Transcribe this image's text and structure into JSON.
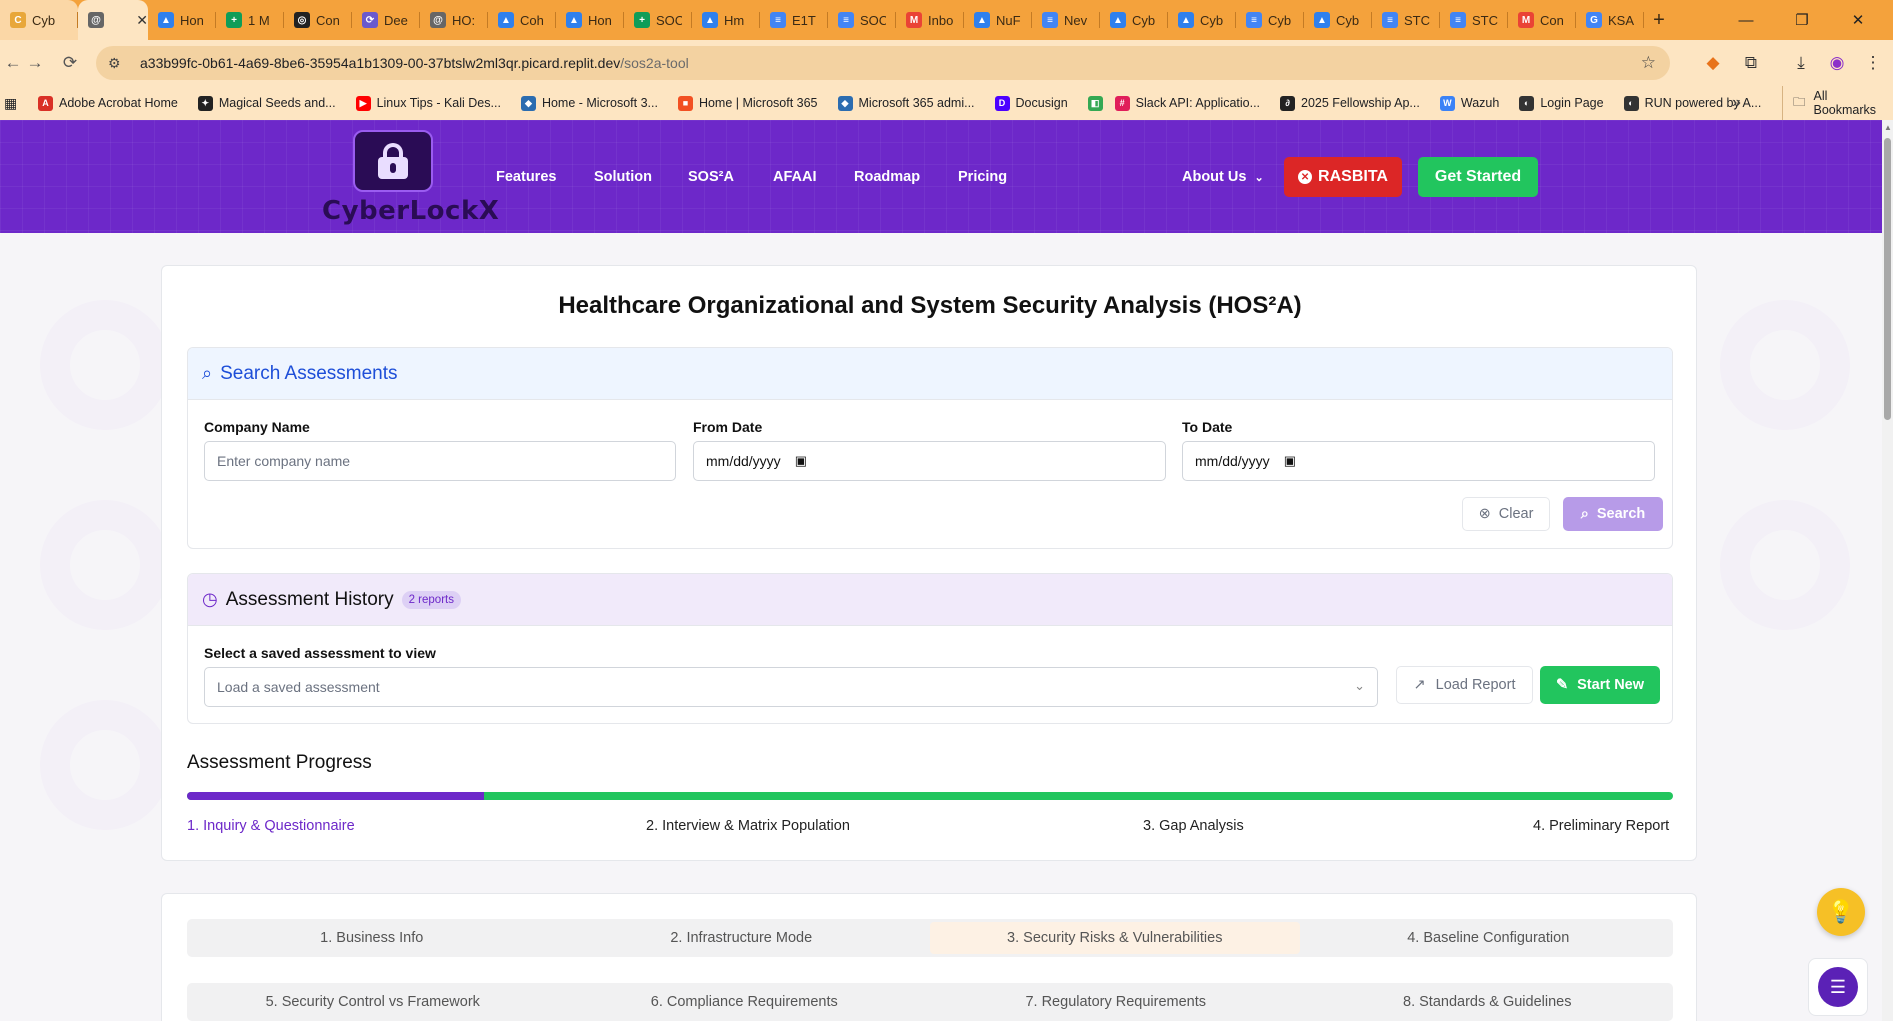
{
  "browser": {
    "tabs": [
      {
        "title": "Cyb",
        "color": "#e8a73a",
        "icon": "C"
      },
      {
        "title": "",
        "color": "#666666",
        "icon": "@",
        "active": true
      },
      {
        "title": "Hon",
        "color": "#2f80ed",
        "icon": "▲"
      },
      {
        "title": "1 M",
        "color": "#0f9d58",
        "icon": "+"
      },
      {
        "title": "Con",
        "color": "#222222",
        "icon": "◎"
      },
      {
        "title": "Dee",
        "color": "#6a5acd",
        "icon": "⟳"
      },
      {
        "title": "HO:",
        "color": "#666666",
        "icon": "@"
      },
      {
        "title": "Coh",
        "color": "#2f80ed",
        "icon": "▲"
      },
      {
        "title": "Hon",
        "color": "#2f80ed",
        "icon": "▲"
      },
      {
        "title": "SOC",
        "color": "#0f9d58",
        "icon": "+"
      },
      {
        "title": "Hm",
        "color": "#2f80ed",
        "icon": "▲"
      },
      {
        "title": "E1T",
        "color": "#4285f4",
        "icon": "≡"
      },
      {
        "title": "SOC",
        "color": "#4285f4",
        "icon": "≡"
      },
      {
        "title": "Inbo",
        "color": "#ea4335",
        "icon": "M"
      },
      {
        "title": "NuF",
        "color": "#2f80ed",
        "icon": "▲"
      },
      {
        "title": "Nev",
        "color": "#4285f4",
        "icon": "≡"
      },
      {
        "title": "Cyb",
        "color": "#2f80ed",
        "icon": "▲"
      },
      {
        "title": "Cyb",
        "color": "#2f80ed",
        "icon": "▲"
      },
      {
        "title": "Cyb",
        "color": "#4285f4",
        "icon": "≡"
      },
      {
        "title": "Cyb",
        "color": "#2f80ed",
        "icon": "▲"
      },
      {
        "title": "STC",
        "color": "#4285f4",
        "icon": "≡"
      },
      {
        "title": "STC",
        "color": "#4285f4",
        "icon": "≡"
      },
      {
        "title": "Con",
        "color": "#ea4335",
        "icon": "M"
      },
      {
        "title": "KSA",
        "color": "#4285f4",
        "icon": "G"
      }
    ],
    "url_host": "a33b99fc-0b61-4a69-8be6-35954a1b1309-00-37btslw2ml3qr.picard.replit.dev",
    "url_path": "/sos2a-tool",
    "bookmarks": [
      {
        "label": "Adobe Acrobat Home",
        "color": "#d93025",
        "icon": "A"
      },
      {
        "label": "Magical Seeds and...",
        "color": "#222222",
        "icon": "✦"
      },
      {
        "label": "Linux Tips - Kali Des...",
        "color": "#ff0000",
        "icon": "▶"
      },
      {
        "label": "Home - Microsoft 3...",
        "color": "#2b6cb0",
        "icon": "◆"
      },
      {
        "label": "Home | Microsoft 365",
        "color": "#f25022",
        "icon": "■"
      },
      {
        "label": "Microsoft 365 admi...",
        "color": "#2b6cb0",
        "icon": "◆"
      },
      {
        "label": "Docusign",
        "color": "#4c00ff",
        "icon": "D"
      },
      {
        "label": "",
        "color": "#34a853",
        "icon": "◧"
      },
      {
        "label": "Slack API: Applicatio...",
        "color": "#e01e5a",
        "icon": "#"
      },
      {
        "label": "2025 Fellowship Ap...",
        "color": "#222222",
        "icon": "∂"
      },
      {
        "label": "Wazuh",
        "color": "#3b82f6",
        "icon": "W"
      },
      {
        "label": "Login Page",
        "color": "#333333",
        "icon": "◐"
      },
      {
        "label": "RUN powered by A...",
        "color": "#333333",
        "icon": "◐"
      }
    ],
    "all_bookmarks": "All Bookmarks"
  },
  "header": {
    "logo_text": "CyberLockX",
    "nav": [
      "Features",
      "Solution",
      "SOS²A",
      "AFAAI",
      "Roadmap",
      "Pricing"
    ],
    "about": "About Us",
    "rasbita_label": "RASBITA",
    "get_started_label": "Get Started"
  },
  "page": {
    "title": "Healthcare Organizational and System Security Analysis (HOS²A)"
  },
  "search": {
    "title": "Search Assessments",
    "company_label": "Company Name",
    "company_placeholder": "Enter company name",
    "from_label": "From Date",
    "from_value": "mm/dd/yyyy",
    "to_label": "To Date",
    "to_value": "mm/dd/yyyy",
    "clear_label": "Clear",
    "search_label": "Search"
  },
  "history": {
    "title": "Assessment History",
    "badge": "2 reports",
    "select_label": "Select a saved assessment to view",
    "select_placeholder": "Load a saved assessment",
    "load_label": "Load Report",
    "start_new_label": "Start New"
  },
  "progress": {
    "title": "Assessment Progress",
    "fraction": 0.2,
    "steps": [
      "1. Inquiry & Questionnaire",
      "2. Interview & Matrix Population",
      "3. Gap Analysis",
      "4. Preliminary Report"
    ]
  },
  "form_tabs": {
    "row1": [
      "1. Business Info",
      "2. Infrastructure Mode",
      "3. Security Risks & Vulnerabilities",
      "4. Baseline Configuration"
    ],
    "row2": [
      "5. Security Control vs Framework",
      "6. Compliance Requirements",
      "7. Regulatory Requirements",
      "8. Standards & Guidelines"
    ]
  },
  "colors": {
    "brand_purple": "#6d28c9",
    "accent_green": "#22c55e",
    "danger_red": "#dc2626",
    "tabbar_orange": "#f4a23c"
  }
}
